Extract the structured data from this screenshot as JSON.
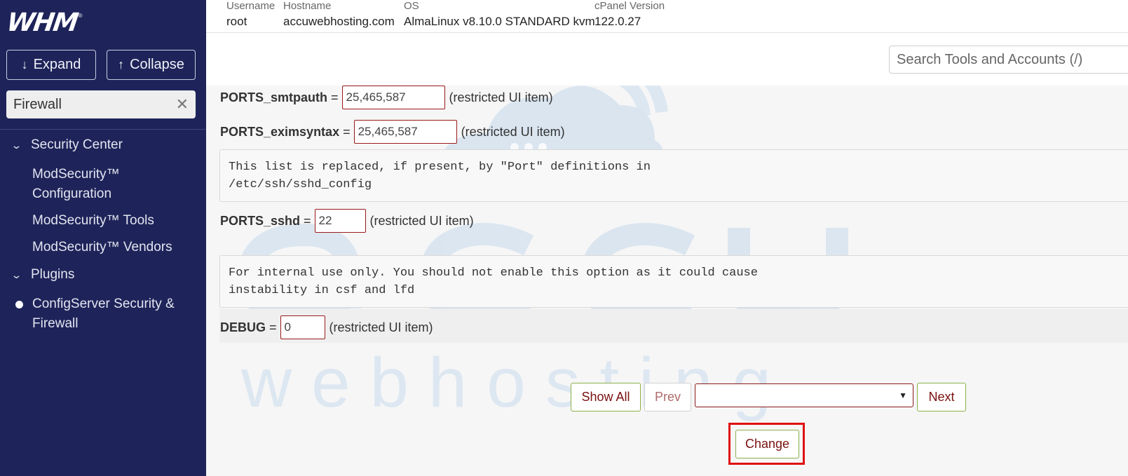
{
  "sidebar": {
    "logo": "WHM",
    "expand_label": "Expand",
    "collapse_label": "Collapse",
    "search_value": "Firewall",
    "categories": [
      {
        "label": "Security Center",
        "items": [
          "ModSecurity™ Configuration",
          "ModSecurity™ Tools",
          "ModSecurity™ Vendors"
        ]
      },
      {
        "label": "Plugins",
        "items": [
          "ConfigServer Security & Firewall"
        ]
      }
    ]
  },
  "server_info": {
    "username_label": "Username",
    "username": "root",
    "hostname_label": "Hostname",
    "hostname": "accuwebhosting.com",
    "os_label": "OS",
    "os": "AlmaLinux v8.10.0 STANDARD kvm",
    "cpanel_label": "cPanel Version",
    "cpanel": "122.0.27"
  },
  "search": {
    "placeholder": "Search Tools and Accounts (/)"
  },
  "config": {
    "smtpauth": {
      "key": "PORTS_smtpauth",
      "value": "25,465,587",
      "note": "(restricted UI item)"
    },
    "eximsyntax": {
      "key": "PORTS_eximsyntax",
      "value": "25,465,587",
      "note": "(restricted UI item)"
    },
    "sshd_comment_1": "This list is replaced, if present, by \"Port\" definitions in",
    "sshd_comment_2": "/etc/ssh/sshd_config",
    "sshd": {
      "key": "PORTS_sshd",
      "value": "22",
      "note": "(restricted UI item)"
    },
    "debug_comment_1": "For internal use only. You should not enable this option as it could cause",
    "debug_comment_2": "instability in csf and lfd",
    "debug": {
      "key": "DEBUG",
      "value": "0",
      "note": "(restricted UI item)"
    },
    "equals": "="
  },
  "pager": {
    "show_all": "Show All",
    "prev": "Prev",
    "next": "Next",
    "select_value": ""
  },
  "actions": {
    "change": "Change"
  },
  "watermark": {
    "word": "accu",
    "tagline": "w e b   h o s t i n g"
  },
  "colors": {
    "sidebar_bg": "#1e2459",
    "field_border": "#9a1a1a",
    "button_border": "#8ab04a",
    "highlight": "#e01010",
    "watermark": "#dbe6f1"
  }
}
